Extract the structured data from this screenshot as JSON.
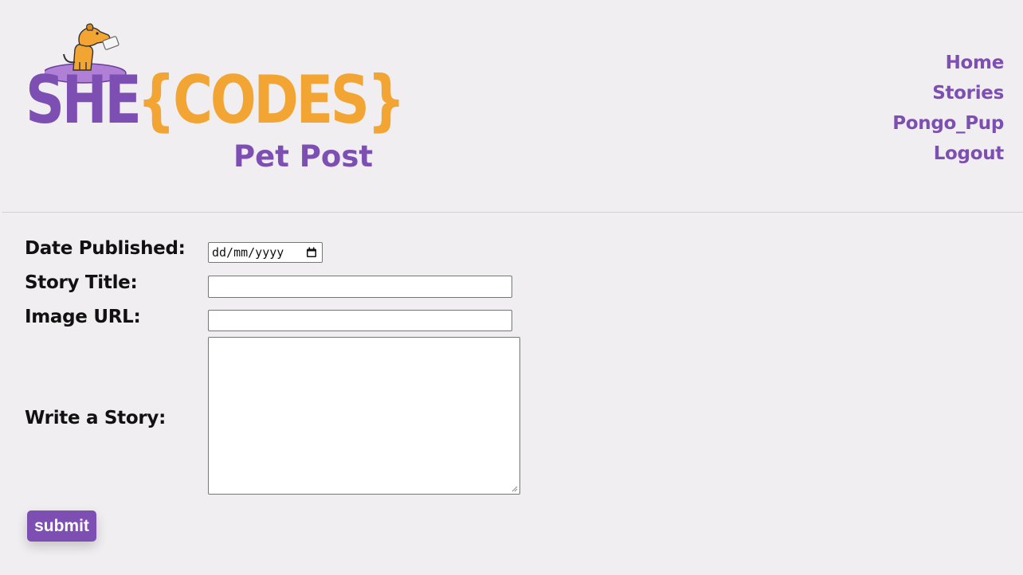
{
  "brand": {
    "she": "SHE",
    "codes": "{CODES}",
    "subtitle": "Pet Post",
    "colors": {
      "purple": "#7d4fb3",
      "orange": "#f2a532"
    }
  },
  "nav": {
    "items": [
      {
        "label": "Home"
      },
      {
        "label": "Stories"
      },
      {
        "label": "Pongo_Pup"
      },
      {
        "label": "Logout"
      }
    ]
  },
  "form": {
    "date_label": "Date Published:",
    "date_placeholder": "dd/mm/yyyy",
    "title_label": "Story Title:",
    "title_value": "",
    "image_label": "Image URL:",
    "image_value": "",
    "story_label": "Write a Story:",
    "story_value": "",
    "submit_label": "submit"
  }
}
